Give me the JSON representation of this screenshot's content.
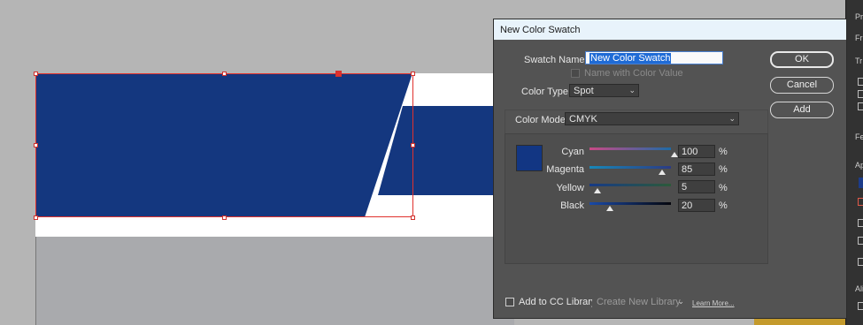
{
  "dialog": {
    "title": "New Color Swatch",
    "swatch_name_label": "Swatch Name:",
    "swatch_name_value": "New Color Swatch",
    "name_with_color_value_label": "Name with Color Value",
    "color_type_label": "Color Type:",
    "color_type_value": "Spot",
    "color_mode_label": "Color Mode:",
    "color_mode_value": "CMYK",
    "preview_color": "#123683",
    "sliders": [
      {
        "label": "Cyan",
        "value": "100",
        "unit": "%"
      },
      {
        "label": "Magenta",
        "value": "85",
        "unit": "%"
      },
      {
        "label": "Yellow",
        "value": "5",
        "unit": "%"
      },
      {
        "label": "Black",
        "value": "20",
        "unit": "%"
      }
    ],
    "buttons": {
      "ok": "OK",
      "cancel": "Cancel",
      "add": "Add"
    },
    "cc_library_label": "Add to CC Library:",
    "cc_library_value": "Create New Library",
    "learn_more": "Learn More..."
  },
  "canvas": {
    "shape_color": "#14377f",
    "selection_color": "#e0312d"
  },
  "dock": {
    "labels": [
      "Pr",
      "Fr",
      "Tr",
      "Fe",
      "Ap",
      "Ali"
    ]
  }
}
